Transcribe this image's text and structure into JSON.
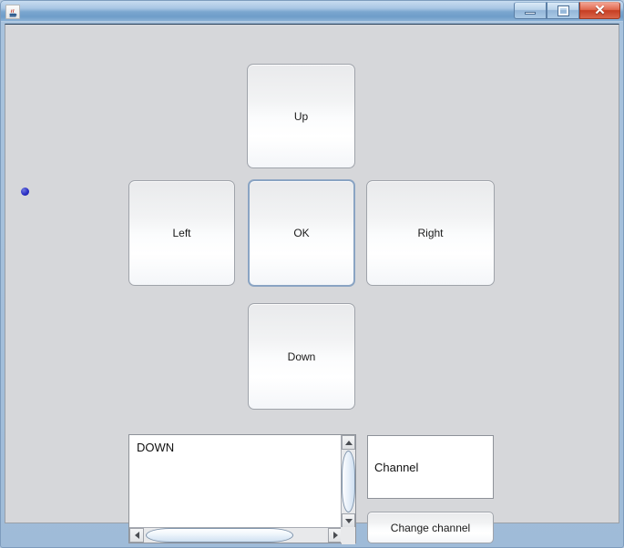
{
  "window": {
    "title": "",
    "icon": "java-coffee-cup-icon",
    "controls": {
      "minimize_label": "–",
      "maximize_label": "□",
      "close_label": "✕"
    }
  },
  "remote": {
    "up_label": "Up",
    "left_label": "Left",
    "ok_label": "OK",
    "right_label": "Right",
    "down_label": "Down",
    "focused_button": "OK"
  },
  "log": {
    "text": "DOWN",
    "scrollbars": {
      "vertical_up": "scroll-up-arrow",
      "vertical_down": "scroll-down-arrow",
      "horizontal_left": "scroll-left-arrow",
      "horizontal_right": "scroll-right-arrow"
    }
  },
  "channel": {
    "value": "Channel",
    "placeholder": "Channel",
    "change_button_label": "Change channel"
  },
  "marker": {
    "name": "blue-dot-marker",
    "color": "#2b2fc6"
  },
  "colors": {
    "panel_background": "#d6d7da",
    "titlebar_blue": "#7ba7cf",
    "focus_border": "#8aa4c3",
    "close_red": "#c63d22"
  }
}
